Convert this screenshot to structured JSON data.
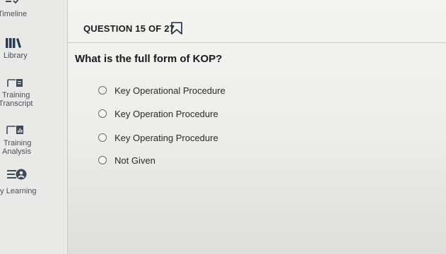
{
  "sidebar": {
    "items": [
      {
        "label": "Timeline",
        "icon": "timeline-icon"
      },
      {
        "label": "Library",
        "icon": "library-icon"
      },
      {
        "label": "Training\nTranscript",
        "label_line1": "Training",
        "label_line2": "Transcript",
        "icon": "transcript-icon"
      },
      {
        "label": "Training\nAnalysis",
        "label_line1": "Training",
        "label_line2": "Analysis",
        "icon": "analysis-icon"
      },
      {
        "label": "My Learning",
        "icon": "my-learning-icon"
      }
    ]
  },
  "question": {
    "header": "QUESTION 15 OF 27",
    "text": "What is the full form of KOP?",
    "options": [
      {
        "label": "Key Operational Procedure"
      },
      {
        "label": "Key Operation Procedure"
      },
      {
        "label": "Key Operating Procedure"
      },
      {
        "label": "Not Given"
      }
    ]
  },
  "colors": {
    "sidebar_bg": "#e9e9e7",
    "main_bg": "#f4f4f2",
    "icon_color": "#3d4a5c",
    "accent": "#2b3a55"
  }
}
